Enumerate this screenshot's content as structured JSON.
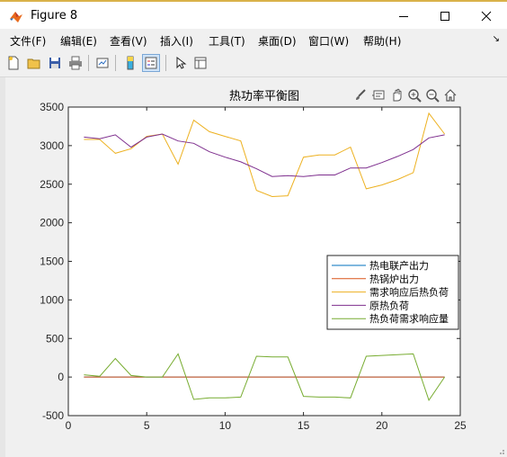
{
  "window": {
    "title": "Figure 8"
  },
  "menus": [
    "文件(F)",
    "编辑(E)",
    "查看(V)",
    "插入(I)",
    "工具(T)",
    "桌面(D)",
    "窗口(W)",
    "帮助(H)"
  ],
  "toolbar": {
    "icons": [
      "new-figure-icon",
      "open-file-icon",
      "save-icon",
      "print-icon",
      "link-plot-icon",
      "insert-colorbar-icon",
      "insert-legend-icon",
      "edit-plot-arrow-icon",
      "property-inspector-icon"
    ],
    "active": "insert-legend-icon"
  },
  "axes_toolbar": {
    "icons": [
      "brush-icon",
      "datatip-icon",
      "pan-hand-icon",
      "zoom-in-icon",
      "zoom-out-icon",
      "home-icon"
    ]
  },
  "chart_data": {
    "type": "line",
    "title": "热功率平衡图",
    "xlabel": "",
    "ylabel": "",
    "xlim": [
      0,
      25
    ],
    "ylim": [
      -500,
      3500
    ],
    "xticks": [
      0,
      5,
      10,
      15,
      20,
      25
    ],
    "yticks": [
      -500,
      0,
      500,
      1000,
      1500,
      2000,
      2500,
      3000,
      3500
    ],
    "grid": false,
    "legend_position": "right",
    "x": [
      1,
      2,
      3,
      4,
      5,
      6,
      7,
      8,
      9,
      10,
      11,
      12,
      13,
      14,
      15,
      16,
      17,
      18,
      19,
      20,
      21,
      22,
      23,
      24
    ],
    "series": [
      {
        "name": "热电联产出力",
        "color": "#0072bd",
        "values": [
          0,
          0,
          0,
          0,
          0,
          0,
          0,
          0,
          0,
          0,
          0,
          0,
          0,
          0,
          0,
          0,
          0,
          0,
          0,
          0,
          0,
          0,
          0,
          0
        ]
      },
      {
        "name": "热锅炉出力",
        "color": "#d95319",
        "values": [
          0,
          0,
          0,
          0,
          0,
          0,
          0,
          0,
          0,
          0,
          0,
          0,
          0,
          0,
          0,
          0,
          0,
          0,
          0,
          0,
          0,
          0,
          0,
          0
        ]
      },
      {
        "name": "需求响应后热负荷",
        "color": "#edb120",
        "values": [
          3080,
          3080,
          2900,
          2960,
          3120,
          3150,
          2760,
          3330,
          3180,
          3120,
          3060,
          2420,
          2340,
          2350,
          2850,
          2880,
          2880,
          2980,
          2440,
          2490,
          2560,
          2650,
          3420,
          3150
        ]
      },
      {
        "name": "原热负荷",
        "color": "#7e2f8e",
        "values": [
          3110,
          3090,
          3140,
          2980,
          3110,
          3150,
          3060,
          3030,
          2920,
          2850,
          2790,
          2700,
          2600,
          2610,
          2600,
          2620,
          2620,
          2710,
          2710,
          2780,
          2860,
          2950,
          3100,
          3140
        ]
      },
      {
        "name": "热负荷需求响应量",
        "color": "#77ac30",
        "values": [
          30,
          10,
          240,
          20,
          0,
          0,
          300,
          -290,
          -270,
          -270,
          -260,
          270,
          260,
          260,
          -250,
          -260,
          -260,
          -270,
          270,
          280,
          290,
          300,
          -300,
          0
        ]
      }
    ]
  }
}
